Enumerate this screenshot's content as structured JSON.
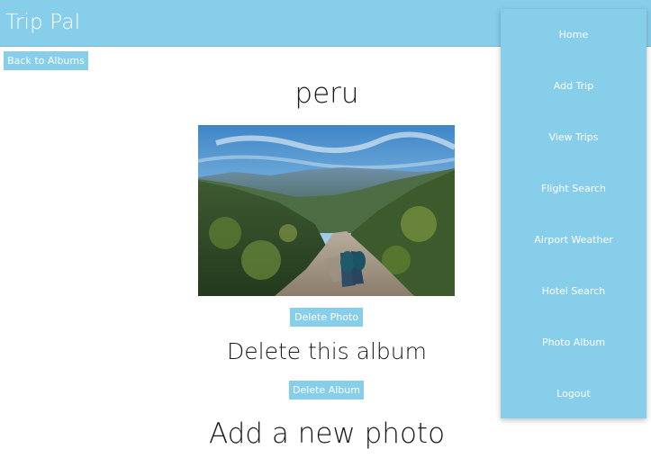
{
  "app": {
    "brand": "Trip Pal"
  },
  "actions": {
    "back_label": "Back to Albums",
    "delete_photo_label": "Delete Photo",
    "delete_album_label": "Delete Album"
  },
  "album": {
    "title": "peru",
    "photo_icon": "mountain-landscape-photo"
  },
  "sections": {
    "delete_album_heading": "Delete this album",
    "add_photo_heading": "Add a new photo"
  },
  "nav": {
    "items": [
      {
        "label": "Home"
      },
      {
        "label": "Add Trip"
      },
      {
        "label": "View Trips"
      },
      {
        "label": "Flight Search"
      },
      {
        "label": "Airport Weather"
      },
      {
        "label": "Hotel Search"
      },
      {
        "label": "Photo Album"
      },
      {
        "label": "Logout"
      }
    ]
  },
  "colors": {
    "accent": "#87ceeb",
    "text": "#1a1a1a",
    "button_text": "#ffffff"
  }
}
